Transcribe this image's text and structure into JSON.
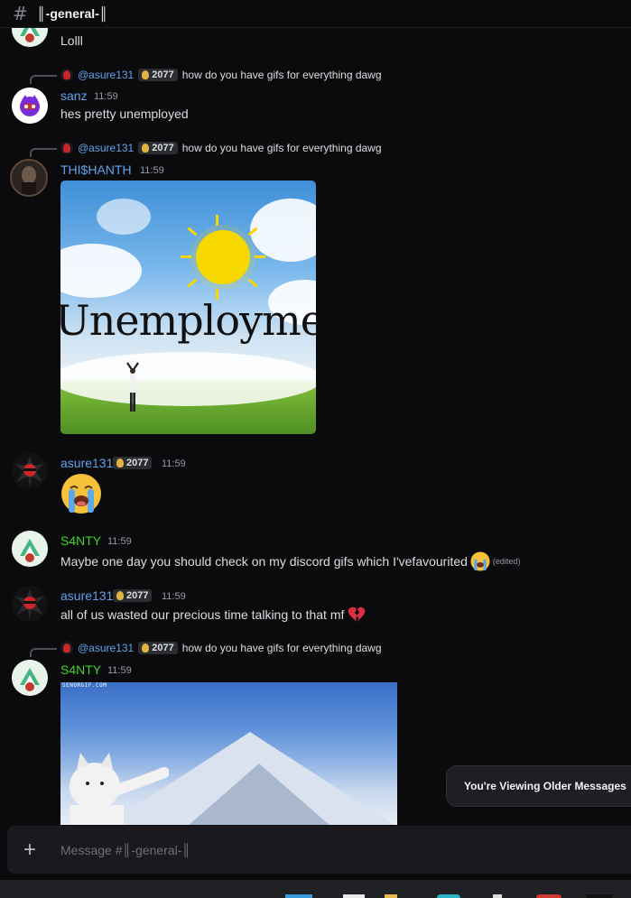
{
  "channel": {
    "hash": "#",
    "title": "║-general-║"
  },
  "messages": {
    "m1": {
      "text": "Lolll"
    },
    "m2": {
      "reply_author": "@asure131",
      "reply_tag": "2077",
      "reply_text": "how do you have gifs for everything dawg",
      "author": "sanz",
      "time": "11:59",
      "text": "hes pretty unemployed"
    },
    "m3": {
      "reply_author": "@asure131",
      "reply_tag": "2077",
      "reply_text": "how do you have gifs for everything dawg",
      "author": "THI$HANTH",
      "time": "11:59",
      "image_text": "Unemploymen"
    },
    "m4": {
      "author": "asure131",
      "tag": "2077",
      "time": "11:59",
      "emoji": "loudly-crying-face"
    },
    "m5": {
      "author": "S4NTY",
      "time": "11:59",
      "text": "Maybe one day you should check on my discord gifs which I'vefavourited",
      "edited": "(edited)"
    },
    "m6": {
      "author": "asure131",
      "tag": "2077",
      "time": "11:59",
      "text": "all of us wasted our precious time talking to that mf"
    },
    "m7": {
      "reply_author": "@asure131",
      "reply_tag": "2077",
      "reply_text": "how do you have gifs for everything dawg",
      "author": "S4NTY",
      "time": "11:59",
      "watermark": "SENORGIF.COM"
    }
  },
  "older_banner": "You're Viewing Older Messages",
  "composer": {
    "plus": "+",
    "placeholder": "Message #║-general-║"
  },
  "colors": {
    "username_blue": "#5fa3ec",
    "username_green": "#3ed626",
    "background": "#0b0b0d"
  }
}
